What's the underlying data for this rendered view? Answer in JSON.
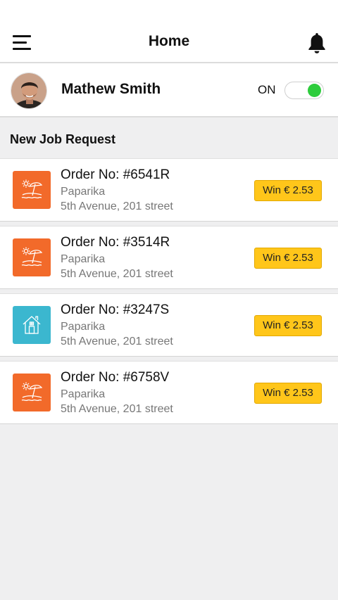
{
  "header": {
    "title": "Home",
    "menu_icon": "hamburger-menu-icon",
    "notification_icon": "bell-icon"
  },
  "profile": {
    "name": "Mathew Smith",
    "status_label": "ON",
    "status_on": true,
    "toggle_color": "#2dcc3c"
  },
  "section": {
    "title": "New Job Request"
  },
  "jobs": [
    {
      "order": "Order No: #6541R",
      "name": "Paparika",
      "address": "5th Avenue, 201 street",
      "reward": "Win € 2.53",
      "icon": "beach-umbrella-icon",
      "icon_color": "#f26a2a"
    },
    {
      "order": "Order No: #3514R",
      "name": "Paparika",
      "address": "5th Avenue, 201 street",
      "reward": "Win € 2.53",
      "icon": "beach-umbrella-icon",
      "icon_color": "#f26a2a"
    },
    {
      "order": "Order No: #3247S",
      "name": "Paparika",
      "address": "5th Avenue, 201 street",
      "reward": "Win € 2.53",
      "icon": "house-icon",
      "icon_color": "#3bb7cf"
    },
    {
      "order": "Order No: #6758V",
      "name": "Paparika",
      "address": "5th Avenue, 201 street",
      "reward": "Win € 2.53",
      "icon": "beach-umbrella-icon",
      "icon_color": "#f26a2a"
    }
  ],
  "colors": {
    "background": "#efeff0",
    "badge": "#ffc61a",
    "beach_tile": "#f26a2a",
    "house_tile": "#3bb7cf"
  }
}
